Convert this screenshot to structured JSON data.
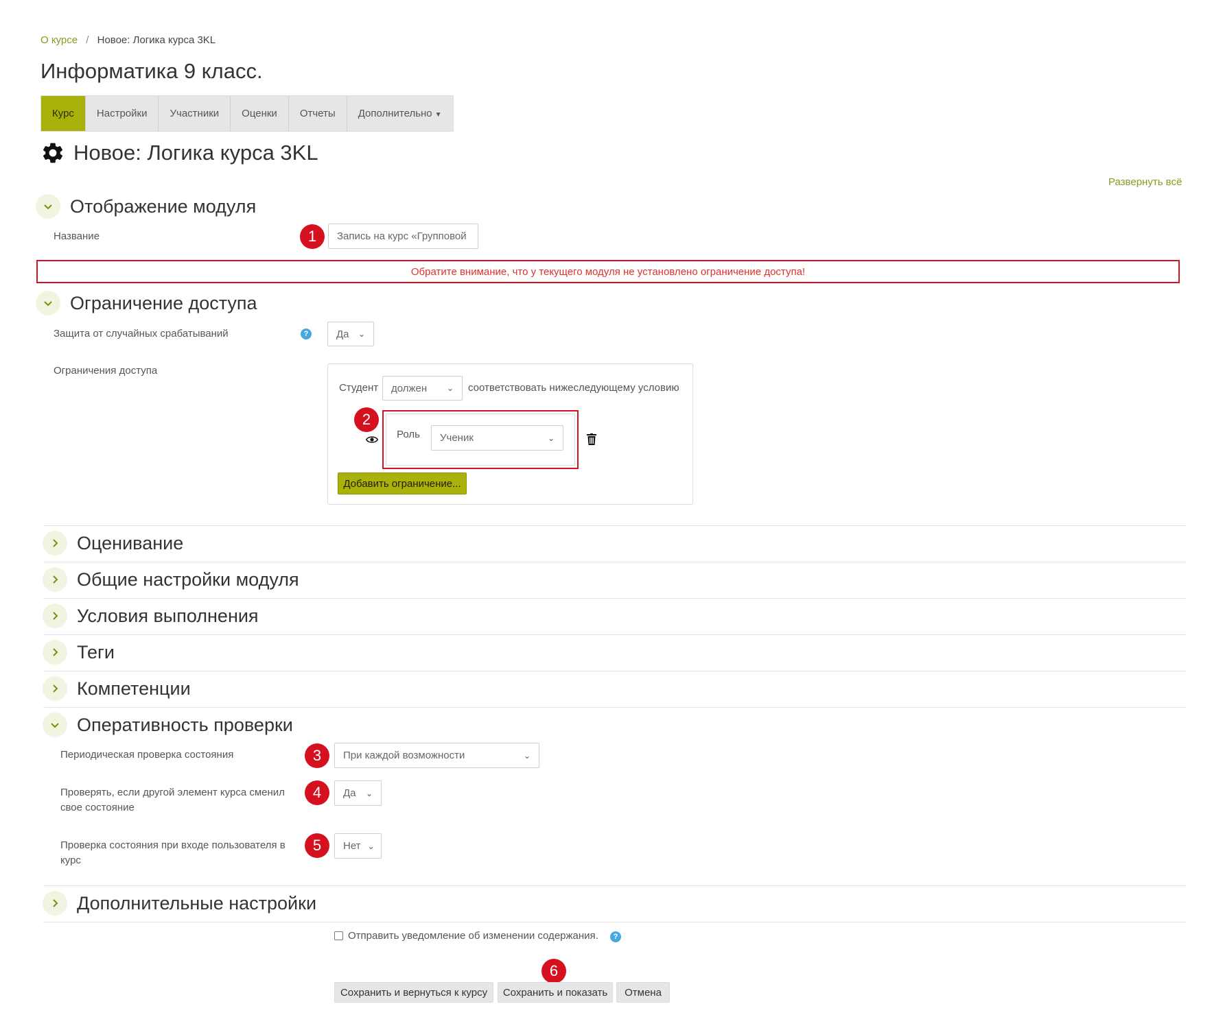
{
  "breadcrumb": {
    "parent": "О курсе",
    "separator": "/",
    "current": "Новое: Логика курса 3KL"
  },
  "course_title": "Информатика 9 класс.",
  "tabs": [
    {
      "label": "Курс",
      "active": true
    },
    {
      "label": "Настройки"
    },
    {
      "label": "Участники"
    },
    {
      "label": "Оценки"
    },
    {
      "label": "Отчеты"
    },
    {
      "label": "Дополнительно",
      "dropdown": true
    }
  ],
  "page_title": {
    "text": "Новое: Логика курса 3KL",
    "icon": "gear-icon"
  },
  "expand_all": "Развернуть всё",
  "module_display": {
    "title": "Отображение модуля",
    "name_label": "Название",
    "name_value": "Запись на курс «Групповой",
    "badge": "1"
  },
  "warning": "Обратите внимание, что у текущего модуля не установлено ограничение доступа!",
  "access": {
    "title": "Ограничение доступа",
    "protection_label": "Защита от случайных срабатываний",
    "protection_value": "Да",
    "restrictions_label": "Ограничения доступа",
    "student_label": "Студент",
    "must_value": "должен",
    "condition_text": "соответствовать нижеследующему условию",
    "badge": "2",
    "role_label": "Роль",
    "role_value": "Ученик",
    "add_button": "Добавить ограничение..."
  },
  "collapsed_sections": [
    {
      "title": "Оценивание"
    },
    {
      "title": "Общие настройки модуля"
    },
    {
      "title": "Условия выполнения"
    },
    {
      "title": "Теги"
    },
    {
      "title": "Компетенции"
    }
  ],
  "check": {
    "title": "Оперативность проверки",
    "periodic_label": "Периодическая проверка состояния",
    "periodic_value": "При каждой возможности",
    "badge3": "3",
    "other_label_1": "Проверять, если другой элемент курса сменил",
    "other_label_2": "свое состояние",
    "other_value": "Да",
    "badge4": "4",
    "login_label_1": "Проверка состояния при входе пользователя в",
    "login_label_2": "курс",
    "login_value": "Нет",
    "badge5": "5"
  },
  "extra_section": {
    "title": "Дополнительные настройки"
  },
  "notify_label": "Отправить уведомление об изменении содержания.",
  "buttons": {
    "save_return": "Сохранить и вернуться к курсу",
    "save_show": "Сохранить и показать",
    "cancel": "Отмена",
    "badge6": "6"
  },
  "colors": {
    "accent": "#a9b20a",
    "link": "#8a9a1f",
    "alert": "#d6111f",
    "help": "#48a8de"
  }
}
